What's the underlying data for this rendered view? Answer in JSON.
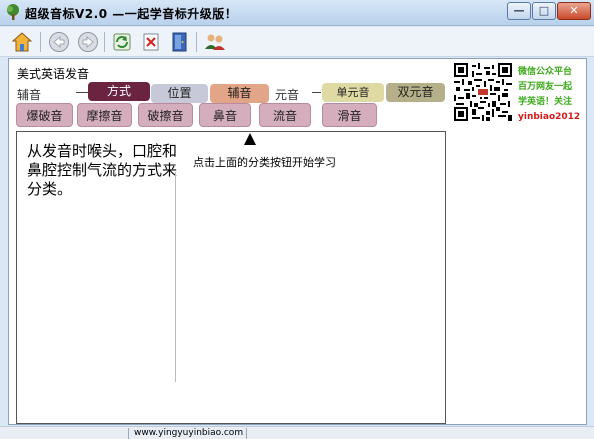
{
  "window": {
    "title": "超级音标V2.0 —一起学音标升级版！",
    "icon": "tree-icon",
    "controls": {
      "minimize": "—",
      "maximize": "□",
      "close": "✕"
    }
  },
  "toolbar": {
    "buttons": [
      {
        "name": "home-button",
        "icon": "home-icon"
      },
      {
        "name": "back-button",
        "icon": "back-arrow-icon"
      },
      {
        "name": "forward-button",
        "icon": "forward-arrow-icon"
      },
      {
        "name": "refresh-button",
        "icon": "refresh-icon"
      },
      {
        "name": "delete-button",
        "icon": "delete-icon"
      },
      {
        "name": "exit-button",
        "icon": "exit-door-icon"
      },
      {
        "name": "users-button",
        "icon": "users-icon"
      }
    ]
  },
  "main": {
    "section_title": "美式英语发音",
    "consonant_label": "辅音",
    "vowel_label": "元音",
    "categories": {
      "manner": "方式",
      "position": "位置",
      "consonant": "辅音",
      "monophthong": "单元音",
      "diphthong": "双元音"
    },
    "sub_buttons": [
      "爆破音",
      "摩擦音",
      "破擦音",
      "鼻音",
      "流音",
      "滑音"
    ],
    "description": "从发音时喉头，口腔和鼻腔控制气流的方式来分类。",
    "hint": "点击上面的分类按钮开始学习",
    "hint_arrow": "▲"
  },
  "promo": {
    "lines": [
      "微信公众平台",
      "百万网友一起",
      "学英语！关注"
    ],
    "account": "yinbiao2012"
  },
  "status": {
    "url": "www.yingyuyinbiao.com"
  },
  "colors": {
    "active_category": "#6b2440",
    "sub_button": "#d4aebd",
    "promo_green": "#3daa1c",
    "promo_red": "#d61a1a"
  }
}
